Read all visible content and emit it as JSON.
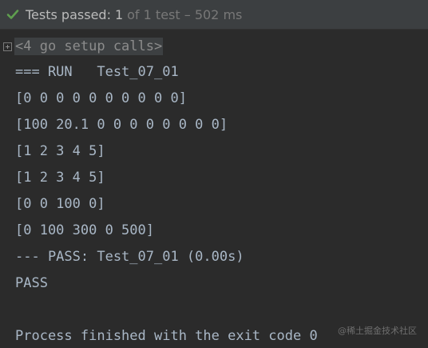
{
  "status": {
    "icon": "check-icon",
    "icon_color": "#5f9f4f",
    "main": "Tests passed:",
    "count": "1",
    "detail": "of 1 test – 502 ms"
  },
  "console": {
    "fold_label": "<4 go setup calls>",
    "lines": [
      "=== RUN   Test_07_01",
      "[0 0 0 0 0 0 0 0 0 0]",
      "[100 20.1 0 0 0 0 0 0 0 0]",
      "[1 2 3 4 5]",
      "[1 2 3 4 5]",
      "[0 0 100 0]",
      "[0 100 300 0 500]",
      "--- PASS: Test_07_01 (0.00s)",
      "PASS",
      "",
      "Process finished with the exit code 0"
    ]
  },
  "watermark": "@稀土掘金技术社区"
}
